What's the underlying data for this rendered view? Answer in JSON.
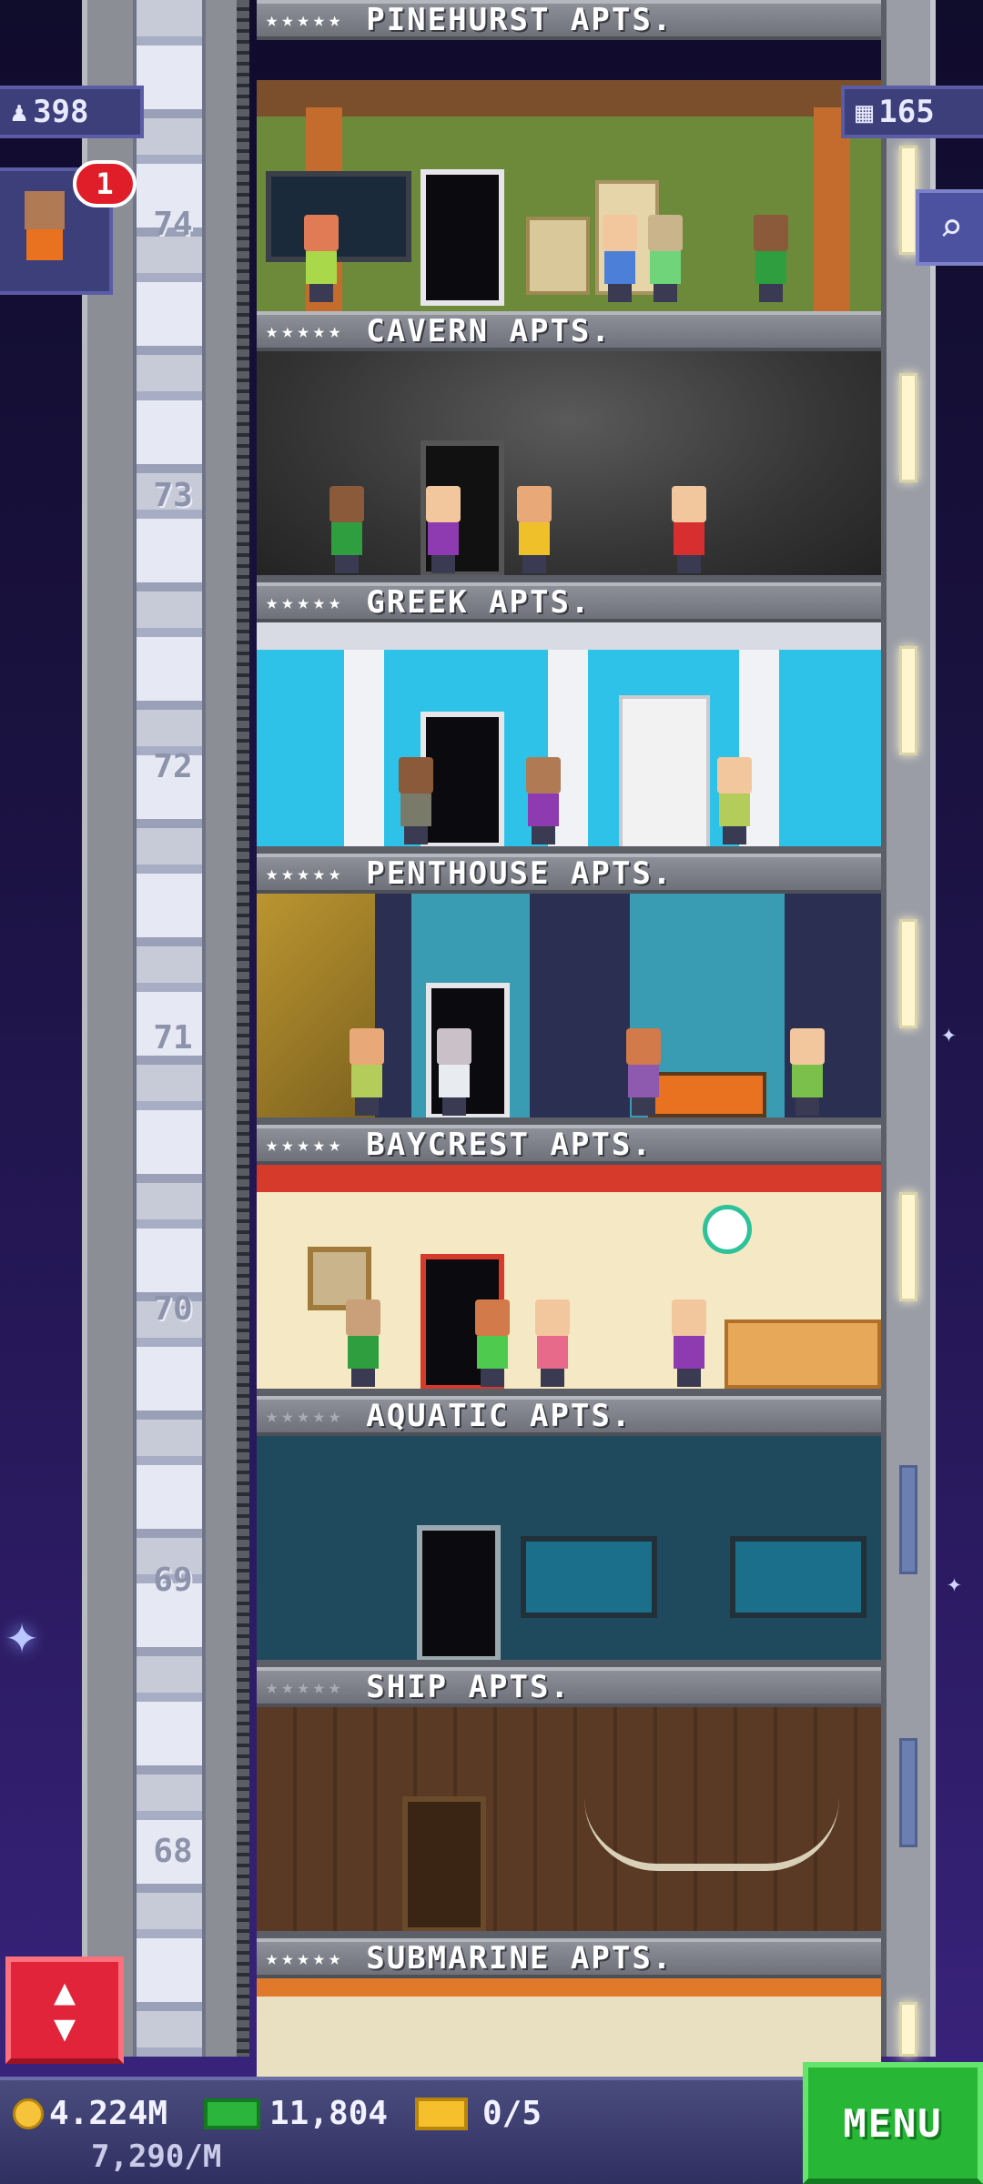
{
  "hud": {
    "population": "398",
    "floors": "165",
    "notification_count": "1"
  },
  "floors": [
    {
      "number": "",
      "name": "PINEHURST APTS.",
      "rating": "★★★★★"
    },
    {
      "number": "74",
      "name": "CAVERN APTS.",
      "rating": "★★★★★"
    },
    {
      "number": "73",
      "name": "GREEK APTS.",
      "rating": "★★★★★"
    },
    {
      "number": "72",
      "name": "PENTHOUSE APTS.",
      "rating": "★★★★★"
    },
    {
      "number": "71",
      "name": "BAYCREST APTS.",
      "rating": "★★★★★"
    },
    {
      "number": "70",
      "name": "AQUATIC APTS.",
      "rating": "★★★★★"
    },
    {
      "number": "69",
      "name": "SHIP APTS.",
      "rating": "★★★★★"
    },
    {
      "number": "68",
      "name": "SUBMARINE APTS.",
      "rating": "★★★★★"
    }
  ],
  "bottom_bar": {
    "coins": "4.224M",
    "coins_rate": "7,290/M",
    "bux": "11,804",
    "tickets": "0/5",
    "menu_label": "MENU"
  },
  "colors": {
    "accent_green": "#27b635",
    "accent_red": "#e1243a",
    "hud_purple": "#3d3f7a"
  }
}
